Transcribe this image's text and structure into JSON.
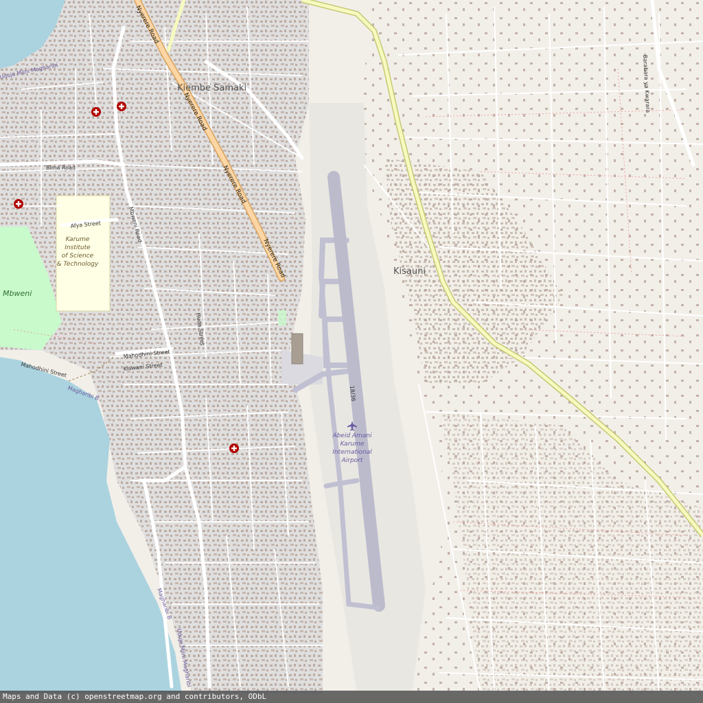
{
  "map": {
    "place_labels": {
      "kiembe_samaki": "Kiembe Samaki",
      "kisauni": "Kisauni",
      "mbweni": "Mbweni"
    },
    "roads": {
      "nyerere_1": "Nyerere Road",
      "nyerere_2": "Nyerere Road",
      "nyerere_3": "Nyerere Road",
      "nyerere_4": "Nyerere Road",
      "mbweni_road": "Mbweni Road",
      "bima_road": "Bima Road",
      "afya_street": "Afya Street",
      "huda_street": "Huda Street",
      "mahodhini_street_1": "Mahodhini Street",
      "mahodhini_street_2": "Mahodhini Street",
      "kiswani_street": "Kiswani Street",
      "barabara_ya_kwarara": "Barabara ya Kwarara"
    },
    "water_labels": {
      "uduja_top": "Uduja Mjini Magharibi",
      "magharibi_b_1": "Magharibi B",
      "magharibi_b_2": "Magharibi B",
      "uduja_bottom": "Uduja Mjini Magharibi"
    },
    "poi": {
      "karume_line1": "Karume",
      "karume_line2": "Institute",
      "karume_line3": "of Science",
      "karume_line4": "& Technology"
    },
    "airport": {
      "line1": "Abeid Amani",
      "line2": "Karume",
      "line3": "International",
      "line4": "Airport",
      "runway": "18/36",
      "icon": "airplane-icon"
    },
    "icons": {
      "hospital": "hospital-icon"
    },
    "colors": {
      "land": "#f2efe9",
      "water": "#aad3df",
      "park": "#c8facc",
      "campus": "#ffffe5",
      "residential": "#e0dfdf",
      "building": "#b8a79d",
      "primary_road": "#fcd6a4",
      "secondary_road": "#f7fabf",
      "runway": "#bbbbcc",
      "hospital": "#b00000"
    }
  },
  "attribution": "Maps and Data (c) openstreetmap.org and contributors, ODbL"
}
